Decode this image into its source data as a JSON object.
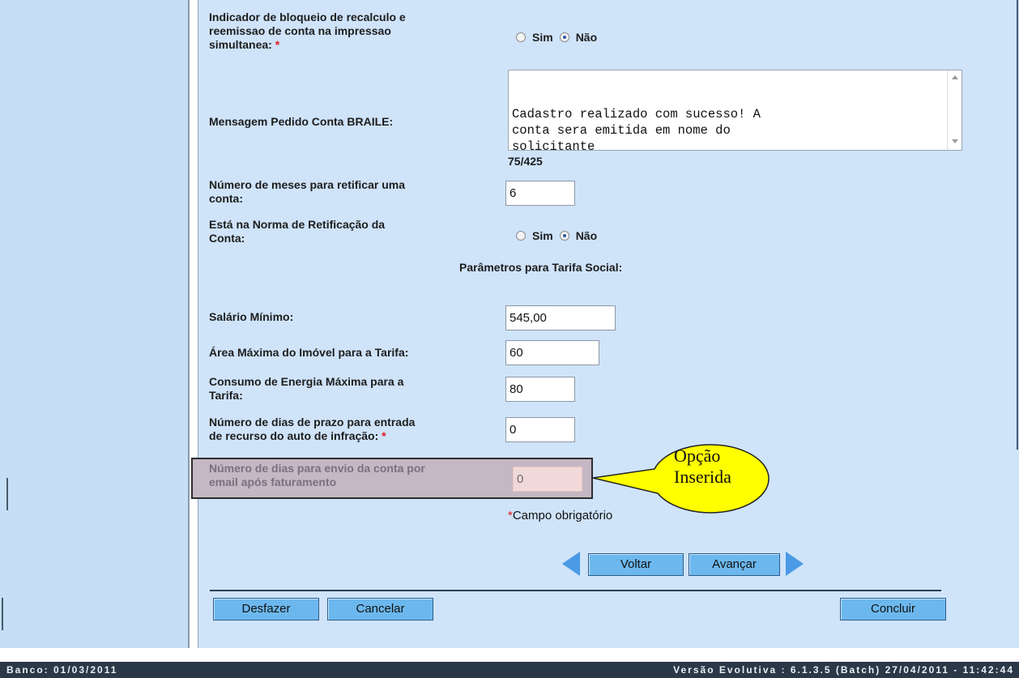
{
  "form": {
    "bloqueio": {
      "label_line1": "Indicador de bloqueio de recalculo e",
      "label_line2": "reemissao de conta na impressao",
      "label_line3": "simultanea:",
      "required_mark": "*",
      "option_yes": "Sim",
      "option_no": "Não",
      "selected": "Não"
    },
    "mensagem_braile": {
      "label": "Mensagem Pedido Conta BRAILE:",
      "value": "Cadastro realizado com sucesso! A\nconta sera emitida em nome do\nsolicitante",
      "char_count": "75/425"
    },
    "meses_retificar": {
      "label_line1": "Número de meses para retificar uma",
      "label_line2": "conta:",
      "value": "6"
    },
    "norma_retificacao": {
      "label_line1": "Está na Norma de Retificação da",
      "label_line2": "Conta:",
      "option_yes": "Sim",
      "option_no": "Não",
      "selected": "Não"
    },
    "tarifa_social_heading": "Parâmetros para Tarifa Social:",
    "salario_minimo": {
      "label": "Salário Mínimo:",
      "value": "545,00"
    },
    "area_maxima": {
      "label": "Área Máxima do Imóvel para a Tarifa:",
      "value": "60"
    },
    "consumo_energia": {
      "label_line1": "Consumo de Energia Máxima para a",
      "label_line2": "Tarifa:",
      "value": "80"
    },
    "dias_recurso": {
      "label_line1": "Número de dias de prazo para entrada",
      "label_line2": "de recurso do auto de infração:",
      "required_mark": "*",
      "value": "0"
    },
    "dias_envio_email": {
      "label_line1": "Número de dias para envio da conta por",
      "label_line2": "email após faturamento",
      "value": "0"
    },
    "required_note_mark": "*",
    "required_note": "Campo obrigatório"
  },
  "callout": {
    "line1": "Opção",
    "line2": "Inserida"
  },
  "buttons": {
    "voltar": "Voltar",
    "avancar": "Avançar",
    "desfazer": "Desfazer",
    "cancelar": "Cancelar",
    "concluir": "Concluir"
  },
  "footer": {
    "banco": "Banco: 01/03/2011",
    "versao": "Versão Evolutiva : 6.1.3.5 (Batch) 27/04/2011 - 11:42:44"
  },
  "colors": {
    "content_bg": "#cfe3f9",
    "sidebar_bg": "#c6dff6",
    "button_bg": "#6cb8ee",
    "callout_fill": "#ffff00",
    "footer_bg": "#2b3847",
    "required": "#e01b1b"
  }
}
